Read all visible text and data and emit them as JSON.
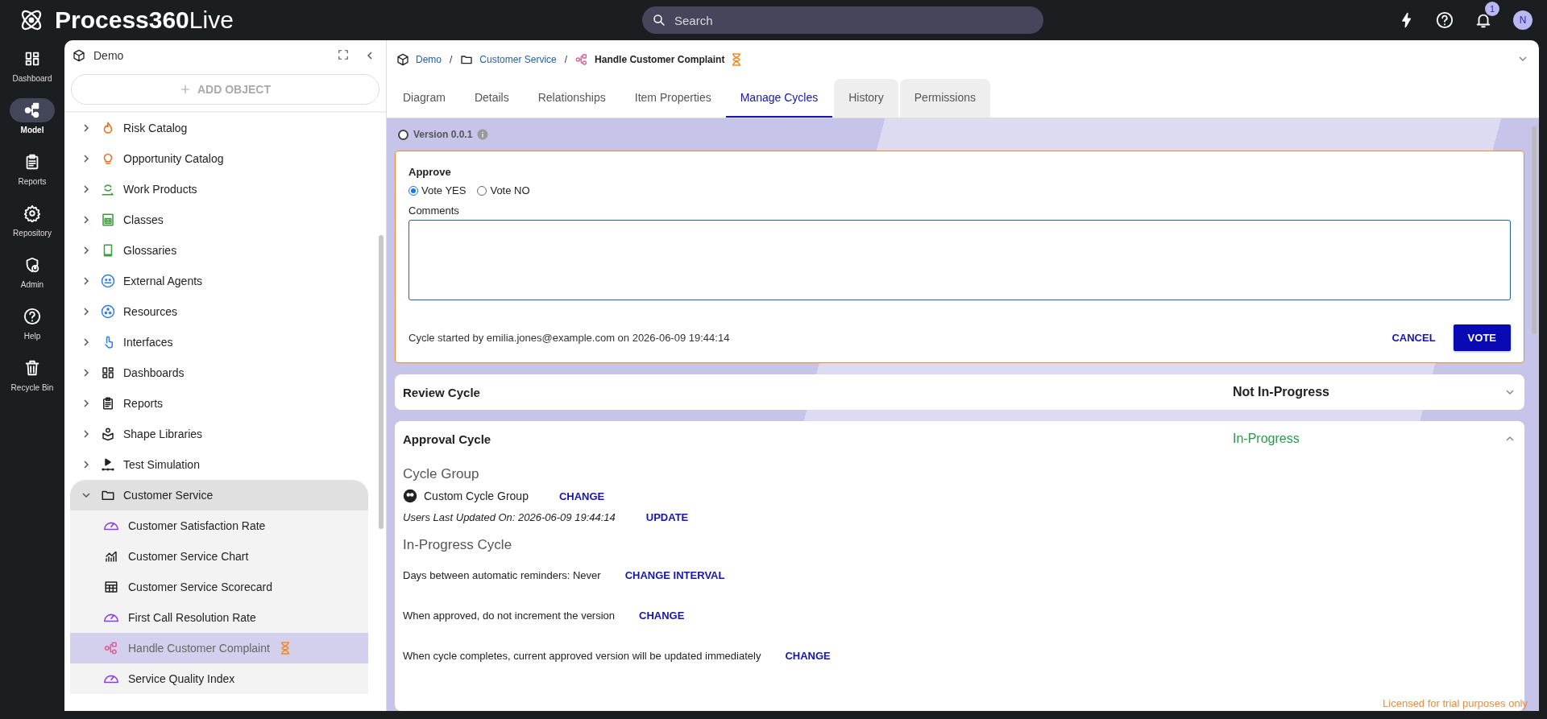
{
  "app": {
    "logo_bold": "Process360",
    "logo_light": "Live"
  },
  "search": {
    "placeholder": "Search"
  },
  "notifications": {
    "count": "1"
  },
  "avatar": {
    "initial": "N"
  },
  "nav": [
    {
      "label": "Dashboard",
      "kind": "dashboard",
      "selected": false
    },
    {
      "label": "Model",
      "kind": "model",
      "selected": true
    },
    {
      "label": "Reports",
      "kind": "clipboard",
      "selected": false
    },
    {
      "label": "Repository",
      "kind": "gear",
      "selected": false
    },
    {
      "label": "Admin",
      "kind": "shield",
      "selected": false
    },
    {
      "label": "Help",
      "kind": "help",
      "selected": false
    },
    {
      "label": "Recycle Bin",
      "kind": "trash",
      "selected": false
    }
  ],
  "tree_panel": {
    "title": "Demo",
    "add_button": "ADD OBJECT",
    "items": [
      {
        "label": "Risk Catalog",
        "kind": "flame",
        "expanded": false
      },
      {
        "label": "Opportunity Catalog",
        "kind": "bulb",
        "expanded": false
      },
      {
        "label": "Work Products",
        "kind": "recycle",
        "expanded": false
      },
      {
        "label": "Classes",
        "kind": "calc",
        "expanded": false
      },
      {
        "label": "Glossaries",
        "kind": "book",
        "expanded": false
      },
      {
        "label": "External Agents",
        "kind": "agents",
        "expanded": false
      },
      {
        "label": "Resources",
        "kind": "resources",
        "expanded": false
      },
      {
        "label": "Interfaces",
        "kind": "touch",
        "expanded": false
      },
      {
        "label": "Dashboards",
        "kind": "dashboard",
        "expanded": false
      },
      {
        "label": "Reports",
        "kind": "clipboard",
        "expanded": false
      },
      {
        "label": "Shape Libraries",
        "kind": "shapes",
        "expanded": false
      },
      {
        "label": "Test Simulation",
        "kind": "play",
        "expanded": false
      },
      {
        "label": "Customer Service",
        "kind": "folder",
        "expanded": true,
        "children": [
          {
            "label": "Customer Satisfaction Rate",
            "kind": "gauge",
            "selected": false,
            "pending": false
          },
          {
            "label": "Customer Service Chart",
            "kind": "chart",
            "selected": false,
            "pending": false
          },
          {
            "label": "Customer Service Scorecard",
            "kind": "table",
            "selected": false,
            "pending": false
          },
          {
            "label": "First Call Resolution Rate",
            "kind": "gauge",
            "selected": false,
            "pending": false
          },
          {
            "label": "Handle Customer Complaint",
            "kind": "process",
            "selected": true,
            "pending": true
          },
          {
            "label": "Service Quality Index",
            "kind": "gauge",
            "selected": false,
            "pending": false
          }
        ]
      }
    ]
  },
  "breadcrumb": [
    {
      "label": "Demo",
      "kind": "cube",
      "current": false
    },
    {
      "separator": "/",
      "label": "Customer Service",
      "kind": "folder",
      "current": false
    },
    {
      "separator": "/",
      "label": "Handle Customer Complaint",
      "kind": "process",
      "current": true
    }
  ],
  "breadcrumb_pending": true,
  "tabs": [
    {
      "label": "Diagram",
      "selected": false,
      "shaded": false
    },
    {
      "label": "Details",
      "selected": false,
      "shaded": false
    },
    {
      "label": "Relationships",
      "selected": false,
      "shaded": false
    },
    {
      "label": "Item Properties",
      "selected": false,
      "shaded": false
    },
    {
      "label": "Manage Cycles",
      "selected": true,
      "shaded": false
    },
    {
      "label": "History",
      "selected": false,
      "shaded": true
    },
    {
      "label": "Permissions",
      "selected": false,
      "shaded": true
    }
  ],
  "version": {
    "label": "Version 0.0.1",
    "selected": false
  },
  "vote_card": {
    "title": "Approve",
    "options": [
      {
        "label": "Vote YES",
        "selected": true
      },
      {
        "label": "Vote NO",
        "selected": false
      }
    ],
    "comments_label": "Comments",
    "started_text": "Cycle started by emilia.jones@example.com on 2026-06-09 19:44:14",
    "cancel": "CANCEL",
    "vote": "VOTE"
  },
  "cycles": [
    {
      "title": "Review Cycle",
      "status": "Not In-Progress",
      "kind": "idle",
      "expanded": false
    },
    {
      "title": "Approval Cycle",
      "status": "In-Progress",
      "kind": "active",
      "expanded": true,
      "details": {
        "cycle_group_heading": "Cycle Group",
        "group_name": "Custom Cycle Group",
        "group_action": "CHANGE",
        "users_updated": "Users Last Updated On: 2026-06-09 19:44:14",
        "update_action": "UPDATE",
        "in_progress_heading": "In-Progress Cycle",
        "settings": [
          {
            "text": "Days between automatic reminders:  Never",
            "action": "CHANGE INTERVAL"
          },
          {
            "text": "When approved, do not increment the version",
            "action": "CHANGE"
          },
          {
            "text": "When cycle completes, current approved version will be updated immediately",
            "action": "CHANGE"
          }
        ]
      }
    }
  ],
  "license_note": "Licensed for trial purposes only"
}
